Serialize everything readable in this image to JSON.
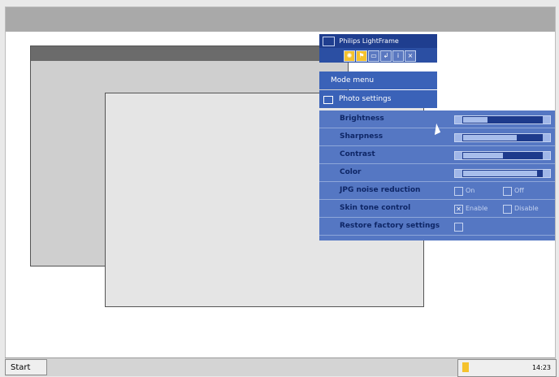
{
  "app": {
    "title": "Philips LightFrame",
    "menus": [
      "Mode menu",
      "Photo settings"
    ]
  },
  "toolbar": {
    "buttons": [
      "bulb-icon",
      "flag-icon",
      "screen-icon",
      "arrow-icon",
      "info-icon",
      "close-icon"
    ]
  },
  "settings": {
    "items": [
      {
        "label": "Brightness",
        "type": "slider",
        "value": 0.3
      },
      {
        "label": "Sharpness",
        "type": "slider",
        "value": 0.65
      },
      {
        "label": "Contrast",
        "type": "slider",
        "value": 0.5
      },
      {
        "label": "Color",
        "type": "slider",
        "value": 0.9
      },
      {
        "label": "JPG noise reduction",
        "type": "radio",
        "options": [
          "On",
          "Off"
        ],
        "selected": null
      },
      {
        "label": "Skin tone control",
        "type": "radio",
        "options": [
          "Enable",
          "Disable"
        ],
        "selected": "Enable"
      },
      {
        "label": "Restore factory settings",
        "type": "button"
      }
    ]
  },
  "taskbar": {
    "start": "Start",
    "clock": "14:23"
  },
  "colors": {
    "panel_dark": "#1f3e8f",
    "panel_mid": "#3a62b8",
    "panel_light": "#5577c3"
  }
}
